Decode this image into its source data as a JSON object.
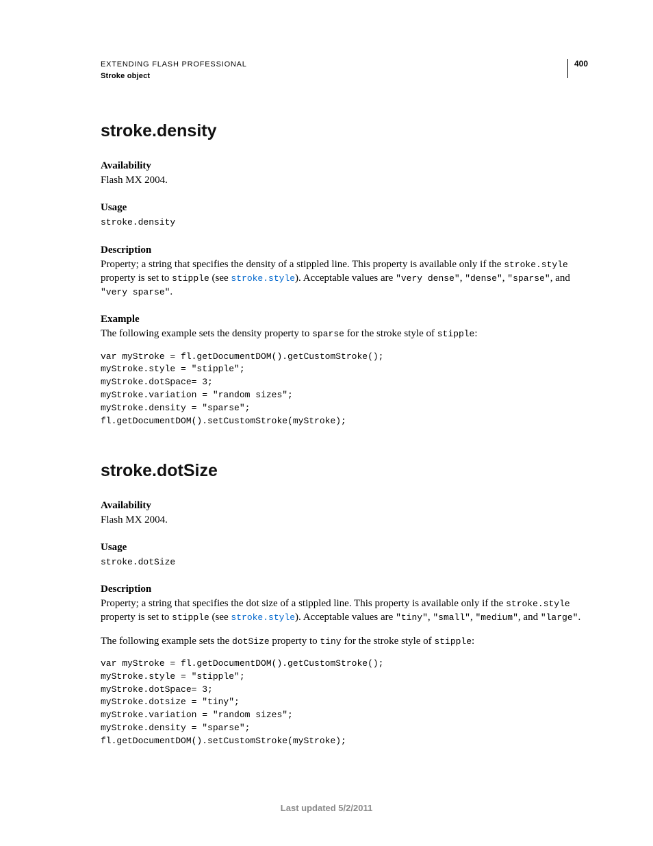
{
  "header": {
    "title": "EXTENDING FLASH PROFESSIONAL",
    "subtitle": "Stroke object",
    "page_number": "400"
  },
  "sections": [
    {
      "heading": "stroke.density",
      "availability_label": "Availability",
      "availability_text": "Flash MX 2004.",
      "usage_label": "Usage",
      "usage_code": "stroke.density",
      "description_label": "Description",
      "description_parts": {
        "p1a": "Property; a string that specifies the density of a stippled line. This property is available only if the ",
        "p1code1": "stroke.style",
        "p1b": " property is set to ",
        "p1code2": "stipple",
        "p1c": " (see ",
        "p1link": "stroke.style",
        "p1d": "). Acceptable values are ",
        "p1code3": "\"very dense\"",
        "p1e": ", ",
        "p1code4": "\"dense\"",
        "p1f": ", ",
        "p1code5": "\"sparse\"",
        "p1g": ", and ",
        "p1code6": "\"very sparse\"",
        "p1h": "."
      },
      "example_label": "Example",
      "example_intro": {
        "a": "The following example sets the density property to ",
        "code1": "sparse",
        "b": " for the stroke style of ",
        "code2": "stipple",
        "c": ":"
      },
      "example_code": "var myStroke = fl.getDocumentDOM().getCustomStroke();\nmyStroke.style = \"stipple\";\nmyStroke.dotSpace= 3;\nmyStroke.variation = \"random sizes\";\nmyStroke.density = \"sparse\";\nfl.getDocumentDOM().setCustomStroke(myStroke);"
    },
    {
      "heading": "stroke.dotSize",
      "availability_label": "Availability",
      "availability_text": "Flash MX 2004.",
      "usage_label": "Usage",
      "usage_code": "stroke.dotSize",
      "description_label": "Description",
      "description_parts": {
        "p1a": "Property; a string that specifies the dot size of a stippled line. This property is available only if the ",
        "p1code1": "stroke.style",
        "p1b": " property is set to ",
        "p1code2": "stipple",
        "p1c": " (see ",
        "p1link": "stroke.style",
        "p1d": "). Acceptable values are ",
        "p1code3": "\"tiny\"",
        "p1e": ", ",
        "p1code4": "\"small\"",
        "p1f": ", ",
        "p1code5": "\"medium\"",
        "p1g": ", and ",
        "p1code6": "\"large\"",
        "p1h": "."
      },
      "example_intro": {
        "a": "The following example sets the ",
        "code1": "dotSize",
        "b": " property to ",
        "code2": "tiny",
        "c": " for the stroke style of ",
        "code3": "stipple",
        "d": ":"
      },
      "example_code": "var myStroke = fl.getDocumentDOM().getCustomStroke();\nmyStroke.style = \"stipple\";\nmyStroke.dotSpace= 3;\nmyStroke.dotsize = \"tiny\";\nmyStroke.variation = \"random sizes\";\nmyStroke.density = \"sparse\";\nfl.getDocumentDOM().setCustomStroke(myStroke);"
    }
  ],
  "footer": "Last updated 5/2/2011"
}
